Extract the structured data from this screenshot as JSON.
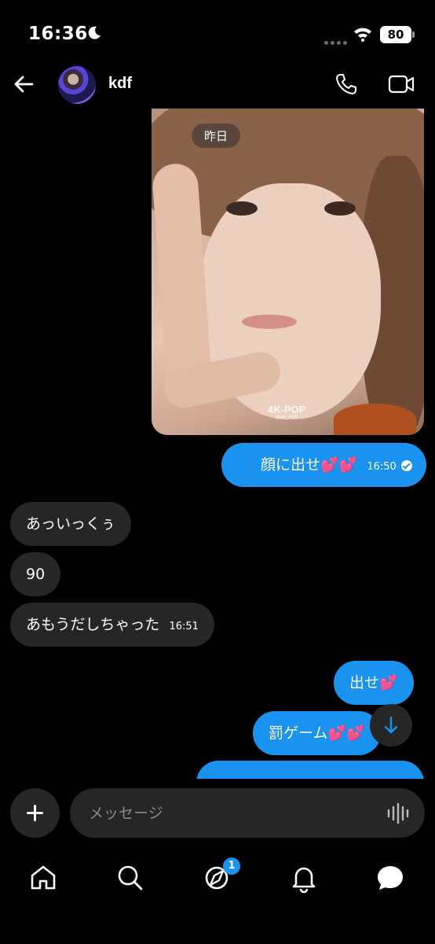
{
  "status_bar": {
    "time": "16:36",
    "battery": "80"
  },
  "header": {
    "contact_name": "kdf"
  },
  "image": {
    "date_chip": "昨日",
    "watermark": "4K-POP",
    "watermark_sub": "@4K_POP"
  },
  "messages": [
    {
      "direction": "out",
      "text": "顔に出せ",
      "emoji": "💕💕",
      "time": "16:50",
      "read": true
    },
    {
      "direction": "in",
      "text": "あっいっくぅ"
    },
    {
      "direction": "in",
      "text": "90"
    },
    {
      "direction": "in",
      "text": "あもうだしちゃった",
      "time": "16:51"
    },
    {
      "direction": "out",
      "text": "出せ",
      "emoji": "💕"
    },
    {
      "direction": "out",
      "text": "罰ゲーム",
      "emoji": "💕💕"
    }
  ],
  "composer": {
    "placeholder": "メッセージ"
  },
  "nav": {
    "items": [
      "home-icon",
      "search-icon",
      "feed-icon",
      "bell-icon",
      "chat-icon"
    ],
    "feed_badge": "1"
  },
  "colors": {
    "accent": "#1a92f0",
    "bubble_in": "#262626",
    "background": "#000000"
  }
}
